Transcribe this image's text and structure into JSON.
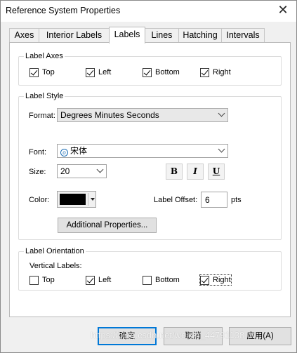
{
  "window": {
    "title": "Reference System Properties"
  },
  "tabs": [
    {
      "label": "Axes",
      "active": false
    },
    {
      "label": "Interior Labels",
      "active": false
    },
    {
      "label": "Labels",
      "active": true
    },
    {
      "label": "Lines",
      "active": false
    },
    {
      "label": "Hatching",
      "active": false
    },
    {
      "label": "Intervals",
      "active": false
    }
  ],
  "label_axes": {
    "title": "Label Axes",
    "items": [
      {
        "label": "Top",
        "checked": true
      },
      {
        "label": "Left",
        "checked": true
      },
      {
        "label": "Bottom",
        "checked": true
      },
      {
        "label": "Right",
        "checked": true
      }
    ]
  },
  "label_style": {
    "title": "Label Style",
    "format_label": "Format:",
    "format_value": "Degrees Minutes Seconds",
    "font_label": "Font:",
    "font_value": "宋体",
    "size_label": "Size:",
    "size_value": "20",
    "bold_label": "B",
    "italic_label": "I",
    "underline_label": "U",
    "color_label": "Color:",
    "color_value": "#000000",
    "offset_label": "Label Offset:",
    "offset_value": "6",
    "offset_unit": "pts",
    "additional_button": "Additional Properties..."
  },
  "label_orientation": {
    "title": "Label Orientation",
    "vertical_label": "Vertical Labels:",
    "items": [
      {
        "label": "Top",
        "checked": false
      },
      {
        "label": "Left",
        "checked": true
      },
      {
        "label": "Bottom",
        "checked": false
      },
      {
        "label": "Right",
        "checked": true
      }
    ]
  },
  "buttons": {
    "ok": "确定",
    "cancel": "取消",
    "apply": "应用(A)"
  },
  "watermark": "https://blog.csdn.net/weixin_44791138"
}
